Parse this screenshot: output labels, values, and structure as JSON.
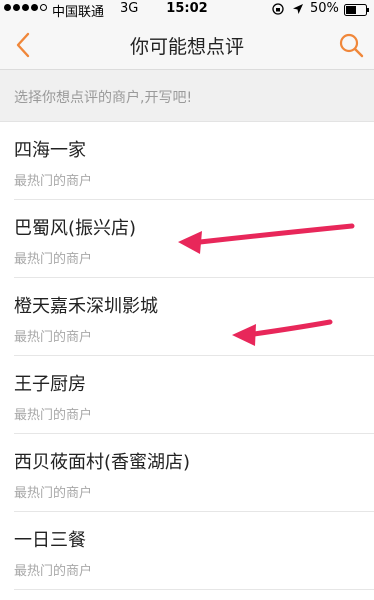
{
  "status_bar": {
    "carrier": "中国联通",
    "network": "3G",
    "time": "15:02",
    "battery": "50%"
  },
  "nav": {
    "title": "你可能想点评",
    "back_icon": "chevron-left-icon",
    "search_icon": "search-icon"
  },
  "hint": "选择你想点评的商户,开写吧!",
  "merchants": [
    {
      "name": "四海一家",
      "sub": "最热门的商户"
    },
    {
      "name": "巴蜀风(振兴店)",
      "sub": "最热门的商户"
    },
    {
      "name": "橙天嘉禾深圳影城",
      "sub": "最热门的商户"
    },
    {
      "name": "王子厨房",
      "sub": "最热门的商户"
    },
    {
      "name": "西贝莜面村(香蜜湖店)",
      "sub": "最热门的商户"
    },
    {
      "name": "一日三餐",
      "sub": "最热门的商户"
    }
  ],
  "colors": {
    "accent": "#f0873a",
    "arrow": "#e8275a"
  }
}
